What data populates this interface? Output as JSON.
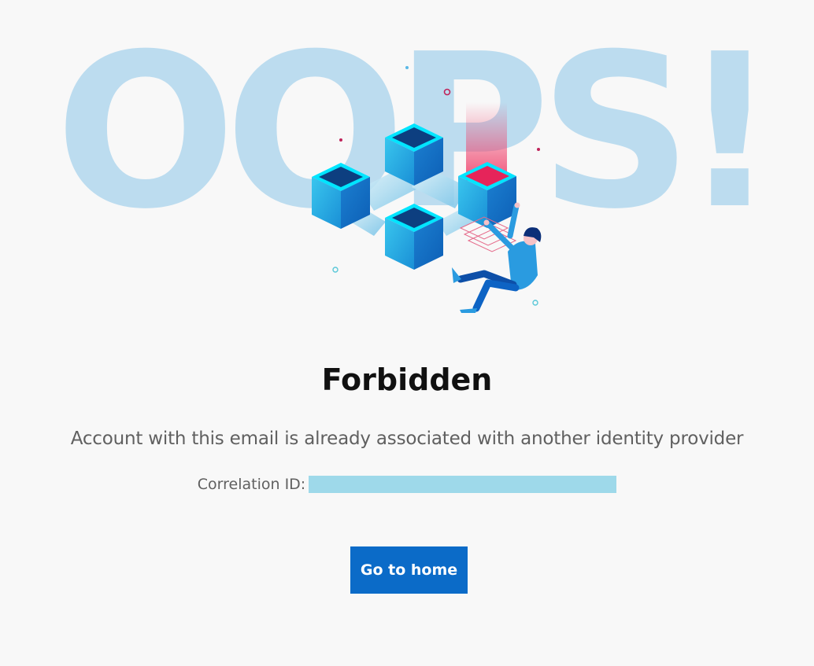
{
  "hero": {
    "background_text": "OOPS!",
    "illustration": "blockchain-cubes-falling-person-illustration"
  },
  "error": {
    "title": "Forbidden",
    "message": "Account with this email is already associated with another identity provider",
    "correlation_label": "Correlation ID:",
    "correlation_value": ""
  },
  "actions": {
    "home_label": "Go to home"
  },
  "colors": {
    "background": "#f8f8f8",
    "oops_text": "#bcdcef",
    "button": "#0b6bc8",
    "redaction": "#9ed9ea",
    "cube_cyan": "#00e5ff",
    "cube_blue": "#1e88d0",
    "accent_pink": "#f0406a"
  }
}
